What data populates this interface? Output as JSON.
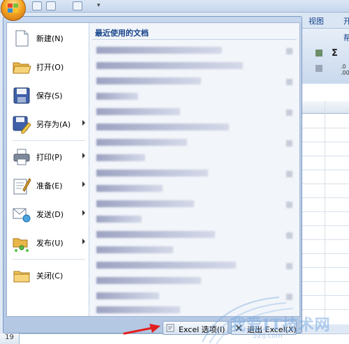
{
  "ribbon": {
    "tab_view": "视图",
    "tab_partial": "开",
    "group_partial": "帮",
    "sigma": "Σ"
  },
  "sheet": {
    "row_number": "19"
  },
  "menu": {
    "items": [
      {
        "label": "新建(N)",
        "icon": "new-document-icon",
        "has_submenu": false
      },
      {
        "label": "打开(O)",
        "icon": "open-folder-icon",
        "has_submenu": false
      },
      {
        "label": "保存(S)",
        "icon": "save-disk-icon",
        "has_submenu": false
      },
      {
        "label": "另存为(A)",
        "icon": "save-as-icon",
        "has_submenu": true
      },
      {
        "label": "打印(P)",
        "icon": "printer-icon",
        "has_submenu": true
      },
      {
        "label": "准备(E)",
        "icon": "prepare-icon",
        "has_submenu": true
      },
      {
        "label": "发送(D)",
        "icon": "send-icon",
        "has_submenu": true
      },
      {
        "label": "发布(U)",
        "icon": "publish-icon",
        "has_submenu": true
      },
      {
        "label": "关闭(C)",
        "icon": "close-folder-icon",
        "has_submenu": false
      }
    ],
    "recent_title": "最近使用的文档",
    "footer": {
      "options_label": "Excel 选项(I)",
      "exit_label": "退出 Excel(X)"
    }
  },
  "watermark": {
    "text": "我爱IT技术网",
    "sub": "52ij.com"
  },
  "colors": {
    "accent": "#15428b",
    "menu_bg": "#c6d7ee",
    "arrow_red": "#e02020"
  }
}
